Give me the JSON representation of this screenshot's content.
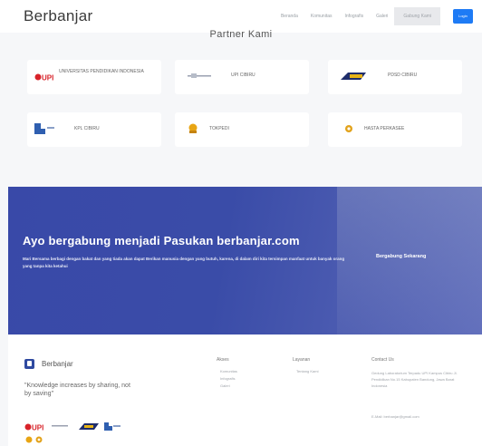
{
  "header": {
    "brand": "Berbanjar",
    "nav": [
      "Beranda",
      "Komunitas",
      "Infografis",
      "Galeri",
      "Gabung Kami"
    ],
    "button_label": "Login"
  },
  "partners": {
    "title": "Partner Kami",
    "items": [
      {
        "name": "UNIVERSITAS PENDIDIKAN INDONESIA",
        "logo": "upi-logo"
      },
      {
        "name": "UPI CIBIRU",
        "logo": "upi-cibiru-logo"
      },
      {
        "name": "PDSD CIBIRU",
        "logo": "pdsd-logo"
      },
      {
        "name": "KPL CIBIRU",
        "logo": "kpl-logo"
      },
      {
        "name": "TOKPEDI",
        "logo": "tokpedi-logo"
      },
      {
        "name": "HASTA PERKASEE",
        "logo": "hasta-logo"
      }
    ]
  },
  "banner": {
    "title": "Ayo bergabung menjadi Pasukan berbanjar.com",
    "text": "Mari Bersama berbagi dengan bakat dan yang tiada akan dapat Berikan manusia dengan yang butuh, karena, di dalam diri kita tersimpan manfaat untuk banyak orang yang tanpa kita ketahui",
    "cta": "Bergabung Sekarang"
  },
  "footer": {
    "brand": "Berbanjar",
    "tagline": "\"Knowledge increases by sharing, not by saving\"",
    "columns": [
      {
        "title": "Akses",
        "items": [
          "Komunitas",
          "Infografis",
          "Galeri"
        ]
      },
      {
        "title": "Layanan",
        "items": [
          "Tentang Kami"
        ]
      }
    ],
    "contact_title": "Contact Us",
    "contact_text": "Gedung Laboratorium Terpadu UPI Kampus Cibiru Jl. Pendidikan No.15 Kabupaten Bandung, Jawa Barat Indonesia",
    "contact_email": "E-Mail: berbanjar@gmail.com"
  },
  "colors": {
    "accent": "#1e7bf5",
    "banner": "#3949a8",
    "brand_dark": "#2f4aa0"
  }
}
